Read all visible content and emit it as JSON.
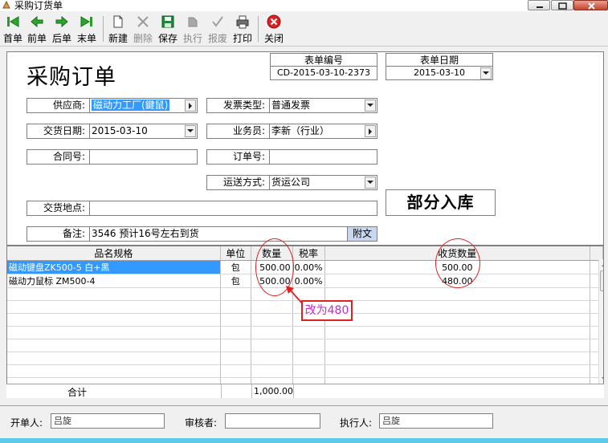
{
  "window": {
    "title": "采购订货单"
  },
  "toolbar": {
    "first": "首单",
    "prev": "前单",
    "next": "后单",
    "last": "末单",
    "new": "新建",
    "delete": "删除",
    "save": "保存",
    "execute": "执行",
    "scrap": "报废",
    "print": "打印",
    "close": "关闭"
  },
  "form": {
    "title": "采购订单",
    "order_no_label": "表单编号",
    "order_no": "CD-2015-03-10-2373",
    "date_label": "表单日期",
    "date": "2015-03-10",
    "supplier_label": "供应商:",
    "supplier": "磁动力工厂(鍵鼠)",
    "invoice_label": "发票类型:",
    "invoice": "普通发票",
    "delivery_date_label": "交货日期:",
    "delivery_date": "2015-03-10",
    "salesman_label": "业务员:",
    "salesman": "李新（行业）",
    "contract_label": "合同号:",
    "contract": "",
    "order_label": "订单号:",
    "order": "",
    "shipping_label": "运送方式:",
    "shipping": "货运公司",
    "place_label": "交货地点:",
    "place": "",
    "status": "部分入库",
    "remark_label": "备注:",
    "remark": "3546  预计16号左右到货",
    "attach": "附文"
  },
  "grid": {
    "headers": {
      "name": "品名规格",
      "unit": "单位",
      "qty": "数量",
      "tax": "税率",
      "received": "收货数量"
    },
    "rows": [
      {
        "name": "磁动键盘ZK500-5 白+黑",
        "unit": "包",
        "qty": "500.00",
        "tax": "0.00%",
        "received": "500.00"
      },
      {
        "name": "磁动力鼠标 ZM500-4",
        "unit": "包",
        "qty": "500.00",
        "tax": "0.00%",
        "received": "480.00"
      }
    ],
    "total_label": "合计",
    "total_qty": "1,000.00"
  },
  "annotation": {
    "note": "改为480",
    "color": "#e02020"
  },
  "footer": {
    "creator_label": "开单人:",
    "creator": "吕旋",
    "reviewer_label": "审核者:",
    "reviewer": "",
    "executor_label": "执行人:",
    "executor": "吕旋"
  }
}
